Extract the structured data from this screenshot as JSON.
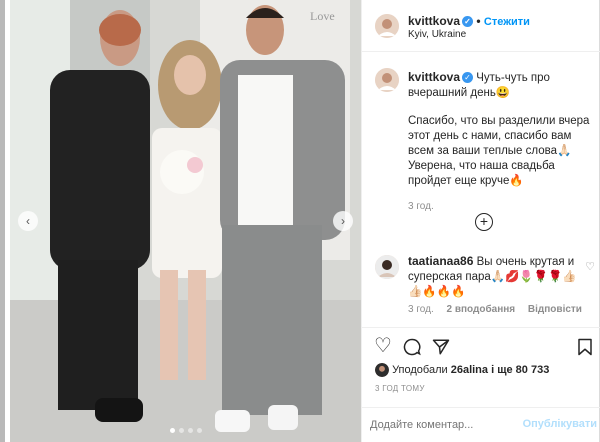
{
  "post": {
    "username": "kvittkova",
    "follow_label": "Стежити",
    "location": "Kyiv, Ukraine",
    "caption_line1": "Чуть-чуть про вчерашний день😃",
    "caption_line2": "Спасибо, что вы разделили вчера этот день с нами, спасибо вам всем за ваши теплые слова🙏🏻 Уверена, что наша свадьба пройдет еще круче🔥",
    "caption_time": "3 год.",
    "photo_sign": "Love"
  },
  "comment": {
    "username": "taatianaa86",
    "text": "Вы очень крутая и суперская пара🙏🏻💋🌷🌹🌹👍🏻👍🏻🔥🔥🔥",
    "time": "3 год.",
    "likes": "2 вподобання",
    "reply": "Відповісти"
  },
  "likes": {
    "prefix": "Уподобали",
    "user": "26alina",
    "suffix": "і ще 80 733"
  },
  "posted_ago": "3 ГОД ТОМУ",
  "add_comment": {
    "placeholder": "Додайте коментар...",
    "publish": "Опублікувати"
  },
  "icons": {
    "heart": "heart-icon",
    "comment": "comment-icon",
    "share": "share-icon",
    "save": "bookmark-icon"
  },
  "colors": {
    "link_blue": "#0095f6",
    "muted": "#8e8e8e",
    "verified": "#3897f0"
  }
}
